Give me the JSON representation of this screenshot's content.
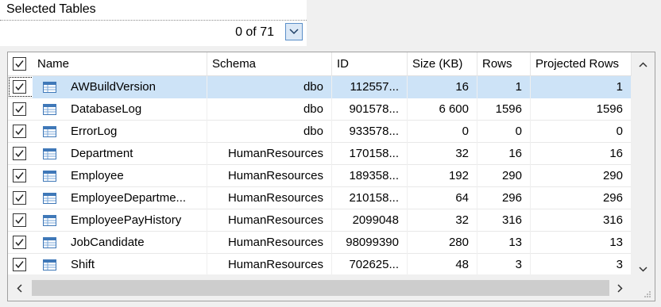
{
  "header": {
    "title": "Selected Tables",
    "count": "0 of 71"
  },
  "columns": [
    "Name",
    "Schema",
    "ID",
    "Size (KB)",
    "Rows",
    "Projected Rows"
  ],
  "rows": [
    {
      "name": "AWBuildVersion",
      "schema": "dbo",
      "id": "112557...",
      "size": "16",
      "rows": "1",
      "projected": "1",
      "checked": true,
      "selected": true
    },
    {
      "name": "DatabaseLog",
      "schema": "dbo",
      "id": "901578...",
      "size": "6 600",
      "rows": "1596",
      "projected": "1596",
      "checked": true
    },
    {
      "name": "ErrorLog",
      "schema": "dbo",
      "id": "933578...",
      "size": "0",
      "rows": "0",
      "projected": "0",
      "checked": true
    },
    {
      "name": "Department",
      "schema": "HumanResources",
      "id": "170158...",
      "size": "32",
      "rows": "16",
      "projected": "16",
      "checked": true
    },
    {
      "name": "Employee",
      "schema": "HumanResources",
      "id": "189358...",
      "size": "192",
      "rows": "290",
      "projected": "290",
      "checked": true
    },
    {
      "name": "EmployeeDepartme...",
      "schema": "HumanResources",
      "id": "210158...",
      "size": "64",
      "rows": "296",
      "projected": "296",
      "checked": true
    },
    {
      "name": "EmployeePayHistory",
      "schema": "HumanResources",
      "id": "2099048",
      "size": "32",
      "rows": "316",
      "projected": "316",
      "checked": true
    },
    {
      "name": "JobCandidate",
      "schema": "HumanResources",
      "id": "98099390",
      "size": "280",
      "rows": "13",
      "projected": "13",
      "checked": true
    },
    {
      "name": "Shift",
      "schema": "HumanResources",
      "id": "702625...",
      "size": "48",
      "rows": "3",
      "projected": "3",
      "checked": true
    }
  ],
  "icons": {
    "dropdown": "chevron-down-icon",
    "row": "table-icon",
    "scroll_up": "chevron-up-icon",
    "scroll_down": "chevron-down-icon",
    "scroll_left": "chevron-left-icon",
    "scroll_right": "chevron-right-icon"
  },
  "colors": {
    "selection": "#cde3f7",
    "accent": "#5b8fc9"
  }
}
